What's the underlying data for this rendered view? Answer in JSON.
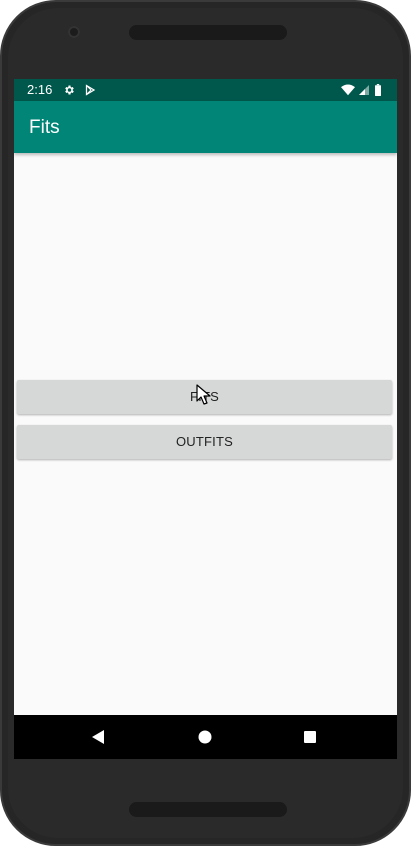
{
  "status_bar": {
    "time": "2:16",
    "icons": [
      "settings-icon",
      "play-store-icon",
      "wifi-icon",
      "signal-icon",
      "battery-icon"
    ],
    "background": "#00574b"
  },
  "app_bar": {
    "title": "Fits",
    "background": "#008577"
  },
  "main": {
    "buttons": [
      {
        "label": "FITS"
      },
      {
        "label": "OUTFITS"
      }
    ],
    "button_color": "#d6d7d7"
  },
  "nav_bar": {
    "icons": [
      "back-icon",
      "home-icon",
      "recents-icon"
    ]
  }
}
